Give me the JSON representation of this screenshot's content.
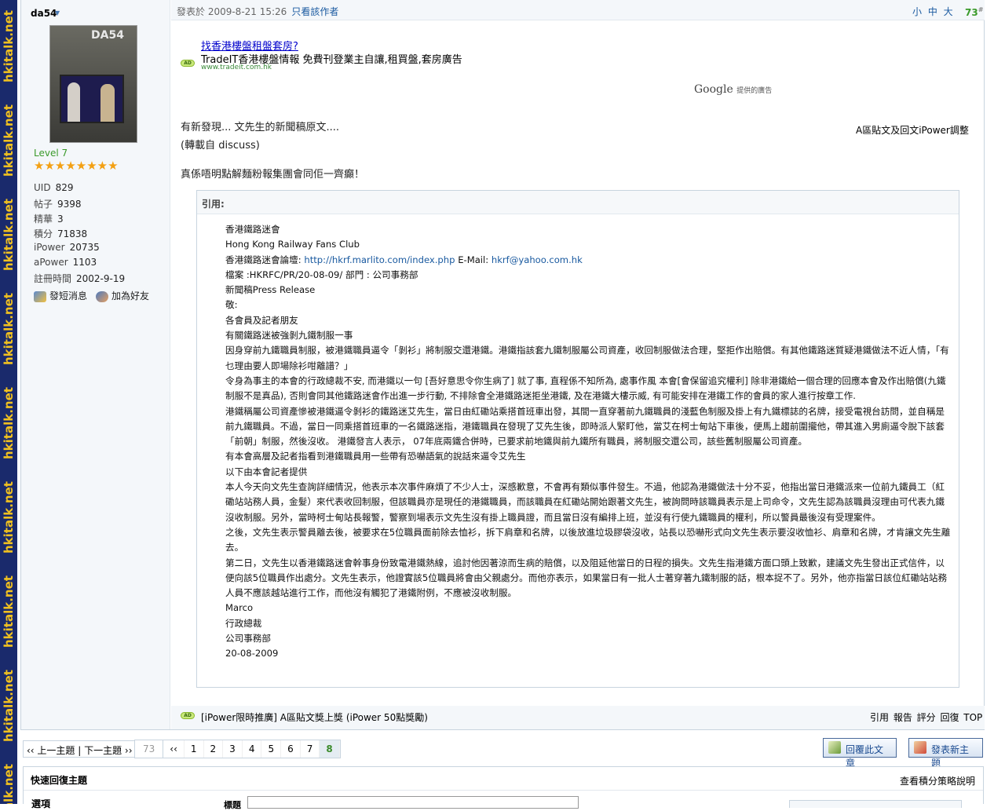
{
  "watermark": "hkitalk.net",
  "author": {
    "name": "da54",
    "avatar_label": "DA54",
    "level": "Level 7",
    "stars": "★★★★★★★★",
    "stats": [
      {
        "k": "UID",
        "v": "829"
      },
      {
        "k": "帖子",
        "v": "9398"
      },
      {
        "k": "精華",
        "v": "3"
      },
      {
        "k": "積分",
        "v": "71838"
      },
      {
        "k": "iPower",
        "v": "20735"
      },
      {
        "k": "aPower",
        "v": "1103"
      },
      {
        "k": "註冊時間",
        "v": "2002-9-19"
      }
    ],
    "pm_label": "發短消息",
    "add_friend_label": "加為好友"
  },
  "post_header": {
    "posted": "發表於 2009-8-21 15:26",
    "only_author": "只看該作者",
    "sizes": "小 中 大",
    "floor": "73",
    "floor_mark": "#"
  },
  "ad1": {
    "badge": "AD",
    "title": "找香港樓盤租盤套房?",
    "desc": "TradeIT香港樓盤情報 免費刊登業主自讓,租買盤,套房廣告",
    "url": "www.tradeit.com.hk"
  },
  "google": {
    "brand": "Google",
    "label": "提供的廣告"
  },
  "ipower_note": "A區貼文及回文iPower調整",
  "body_lines": [
    "有新發現... 文先生的新聞稿原文....",
    "(轉載自 discuss)",
    "真係唔明點解麵粉報集團會同佢一齊癲！"
  ],
  "quote": {
    "head": "引用:",
    "lines": [
      "香港鐵路迷會",
      "Hong Kong Railway Fans Club",
      "檔案 :HKRFC/PR/20-08-09/ 部門 : 公司事務部",
      "新聞稿Press Release",
      "敬:",
      "各會員及記者朋友",
      "有關鐵路迷被強剝九鐵制服一事",
      "因身穿前九鐵職員制服，被港鐵職員逼令「剝衫」將制服交還港鐵。港鐵指該套九鐵制服屬公司資產，收回制服做法合理，堅拒作出賠償。有其他鐵路迷質疑港鐵做法不近人情，「有乜理由要人即場除衫咁離譜？」",
      "令身為事主的本會的行政總裁不安, 而港鐵以一句 [吾好意思令你生病了] 就了事, 直程係不知所為, 處事作風 本會[會保留追究權利] 除非港鐵給一個合理的回應本會及作出賠償(九鐵制服不是真品), 否則會同其他鐵路迷會作出進一步行動, 不排除會全港鐵路迷拒坐港鐵, 及在港鐵大樓示威, 有可能安排在港鐵工作的會員的家人進行按章工作.",
      "港鐵稱屬公司資產慘被港鐵逼令剝衫的鐵路迷艾先生，當日由紅磡站乘搭首班車出發，其間一直穿著前九鐵職員的淺藍色制服及掛上有九鐵標誌的名牌，接受電視台訪問，並自稱是前九鐵職員。不過，當日一同乘搭首班車的一名鐵路迷指，港鐵職員在發現了艾先生後，即時派人緊盯他，當艾在柯士甸站下車後，便馬上趨前圍攏他，帶其進入男廁逼令脫下該套「前朝」制服，然後沒收。 港鐵發言人表示， 07年底兩鐵合併時，已要求前地鐵與前九鐵所有職員，將制服交還公司，該些舊制服屬公司資產。",
      "有本會高層及記者指看到港鐵職員用一些帶有恐嚇語氣的說話來逼令艾先生",
      "以下由本會記者提供",
      "本人今天向文先生查詢詳細情況，他表示本次事件麻煩了不少人士，深感歉意，不會再有類似事件發生。不過，他認為港鐵做法十分不妥，他指出當日港鐵派來一位前九鐵員工（紅磡站站務人員，金髮）來代表收回制服，但該職員亦是現任的港鐵職員，而該職員在紅磡站開始跟著文先生，被詢問時該職員表示是上司命令，文先生認為該職員沒理由可代表九鐵沒收制服。另外，當時柯士甸站長報警，警察到場表示文先生沒有掛上職員證，而且當日沒有編排上班，並沒有行使九鐵職員的權利，所以警員最後沒有受理案件。",
      "之後，文先生表示警員離去後，被要求在5位職員面前除去恤衫，拆下肩章和名牌，以後放進垃圾膠袋沒收，站長以恐嚇形式向文先生表示要沒收恤衫、肩章和名牌，才肯讓文先生離去。",
      "第二日，文先生以香港鐵路迷會幹事身份致電港鐵熱線，追討他因著涼而生病的賠償，以及阻延他當日的日程的損失。文先生指港鐵方面口頭上致歉，建議文先生發出正式信件，以便向該5位職員作出處分。文先生表示，他證實該5位職員將會由父親處分。而他亦表示，如果當日有一批人士著穿著九鐵制服的話，根本捉不了。另外，他亦指當日該位紅磡站站務人員不應該越站進行工作，而他沒有觸犯了港鐵附例，不應被沒收制服。",
      "Marco",
      "行政總裁",
      "公司事務部",
      "20-08-2009"
    ],
    "forum_label": "香港鐵路迷會論壇:",
    "forum_url": "http://hkrf.marlito.com/index.php",
    "email_label": "E-Mail:",
    "email": "hkrf@yahoo.com.hk"
  },
  "footer": {
    "badge": "AD",
    "promo": "[iPower限時推廣] A區貼文獎上獎 (iPower 50點獎勵)",
    "actions": "引用 報告 評分 回復 TOP"
  },
  "nav": {
    "prev": "‹‹ 上一主題",
    "next": "下一主題 ››"
  },
  "pagination": {
    "total": "73",
    "first": "‹‹",
    "pages": [
      "1",
      "2",
      "3",
      "4",
      "5",
      "6",
      "7"
    ],
    "current": "8"
  },
  "buttons": {
    "reply": "回覆此文章",
    "new_topic": "發表新主題"
  },
  "quick_reply": {
    "title": "快速回復主題",
    "policy": "查看積分策略說明",
    "options_label": "選項",
    "title_label": "標題"
  },
  "colors": {
    "stripe": "#1a2a6c",
    "watermark": "#f0c020",
    "link": "#1a5aa0",
    "accent_green": "#3a9a2a"
  }
}
